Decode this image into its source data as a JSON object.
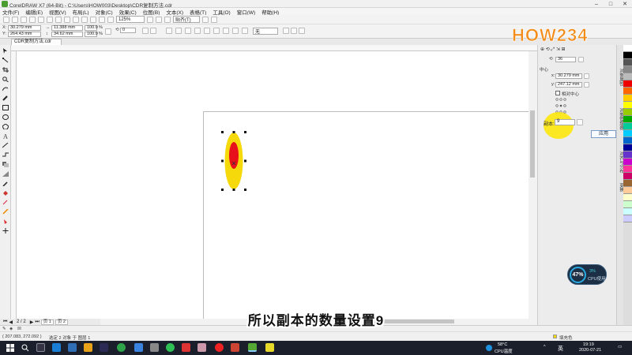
{
  "window": {
    "title": "CorelDRAW X7 (64-Bit) - C:\\Users\\HOW003\\Desktop\\CDR复制方法.cdr"
  },
  "menu": [
    "文件(F)",
    "编辑(E)",
    "视图(V)",
    "布局(L)",
    "对象(C)",
    "效果(C)",
    "位图(B)",
    "文本(X)",
    "表格(T)",
    "工具(O)",
    "窗口(W)",
    "帮助(H)"
  ],
  "toolbar": {
    "zoom": "125%",
    "snap": "贴齐(T)"
  },
  "propbar": {
    "x": "30.279 mm",
    "y": "264.43 mm",
    "w": "11.388 mm",
    "h": "34.62 mm",
    "sx": "100.0",
    "sy": "100.0",
    "pct": "%",
    "angle": "0",
    "outline": "无"
  },
  "doc_tab": "CDR复制方法.cdr",
  "docker": {
    "rotate_value": "36",
    "center_label": "中心",
    "cx": "30.279 mm",
    "cy": "247.12 mm",
    "relative_center": "相对中心",
    "copies_label": "副本:",
    "copies_value": "9",
    "apply": "应用"
  },
  "dock_tabs": [
    "对象属性",
    "对象管理器",
    "对齐与分布",
    "变换"
  ],
  "pagenav": {
    "pages": "2 / 2",
    "page1": "页 1",
    "page2": "页 2"
  },
  "status": {
    "coords": "( 207.083, 272.092 )",
    "selection": "选定 2 对象 于 图层 1",
    "fill": "填充色"
  },
  "cpu": {
    "percent": "47%",
    "load": "3%",
    "label": "CPU使用"
  },
  "logo_text": "HOW234",
  "subtitle": "所以副本的数量设置9",
  "taskbar": {
    "temp": "58°C",
    "temp_label": "CPU温度",
    "lang": "英",
    "time": "19:19",
    "date": "2020-07-21"
  },
  "colors": {
    "ellipse_outer": "#f5d90a",
    "ellipse_inner": "#e8101a",
    "highlight": "#ffe600",
    "accent": "#2aa9e0"
  }
}
